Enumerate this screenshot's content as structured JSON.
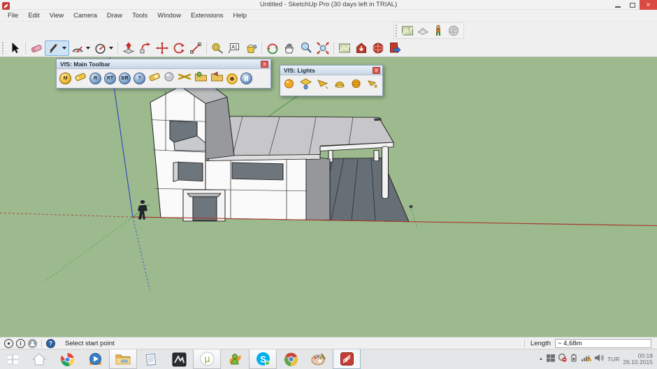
{
  "window": {
    "title": "Untitled - SketchUp Pro (30 days left in TRIAL)",
    "close_glyph": "×"
  },
  "menu": {
    "items": [
      "File",
      "Edit",
      "View",
      "Camera",
      "Draw",
      "Tools",
      "Window",
      "Extensions",
      "Help"
    ]
  },
  "toolbar": {
    "text_tool_label": "A1",
    "tools": [
      "select",
      "eraser",
      "line",
      "arc",
      "circle",
      "push-pull",
      "follow-me",
      "move",
      "rotate",
      "scale",
      "tape-measure",
      "text",
      "paint-bucket",
      "orbit",
      "pan",
      "zoom",
      "zoom-extents",
      "add-location",
      "3d-warehouse",
      "extension-warehouse",
      "send-to-layout"
    ],
    "active_tool": "line"
  },
  "google_toolbar": {
    "tools": [
      "add-location",
      "toggle-terrain",
      "photo-textures",
      "preview-in-google-earth"
    ]
  },
  "palettes": {
    "main": {
      "title": "VfS: Main Toolbar",
      "close_glyph": "x",
      "letters": {
        "m": "M",
        "r": "R",
        "rt": "RT",
        "br": "BR",
        "help": "?"
      },
      "buttons": [
        "material-editor",
        "options",
        "render",
        "rt-render",
        "batch-render",
        "help",
        "frame-buffer",
        "sphere-material",
        "displacement",
        "import-proxy",
        "export-proxy",
        "render-region",
        "pause"
      ]
    },
    "lights": {
      "title": "VfS: Lights",
      "close_glyph": "x",
      "buttons": [
        "omni-light",
        "rectangle-light",
        "spot-light",
        "dome-light",
        "sphere-light",
        "ies-light"
      ]
    }
  },
  "statusbar": {
    "info_glyph": "i",
    "help_glyph": "?",
    "hint": "Select start point",
    "measure_label": "Length",
    "measure_value": "~ 4,68m"
  },
  "taskbar": {
    "buttons": [
      "start",
      "home",
      "chrome",
      "media-player",
      "file-explorer",
      "notepad",
      "dark-app",
      "utorrent",
      "messenger",
      "skype",
      "chrome-legacy",
      "paint",
      "sketchup"
    ],
    "open_buttons": [
      "file-explorer",
      "utorrent",
      "skype",
      "sketchup"
    ],
    "tray": {
      "language": "TUR",
      "time": "00:18",
      "date": "26.10.2015"
    }
  },
  "viewport": {
    "background": "#9cba8e",
    "axis_colors": {
      "red": "#a83a2e",
      "green": "#5a9a4e",
      "blue": "#3c55bb"
    },
    "model_colors": {
      "face": "#fafafa",
      "roof": "#c7c7c9",
      "shadow_wall": "#98999d",
      "glass": "#6d757d",
      "deck": "#666e76"
    }
  }
}
